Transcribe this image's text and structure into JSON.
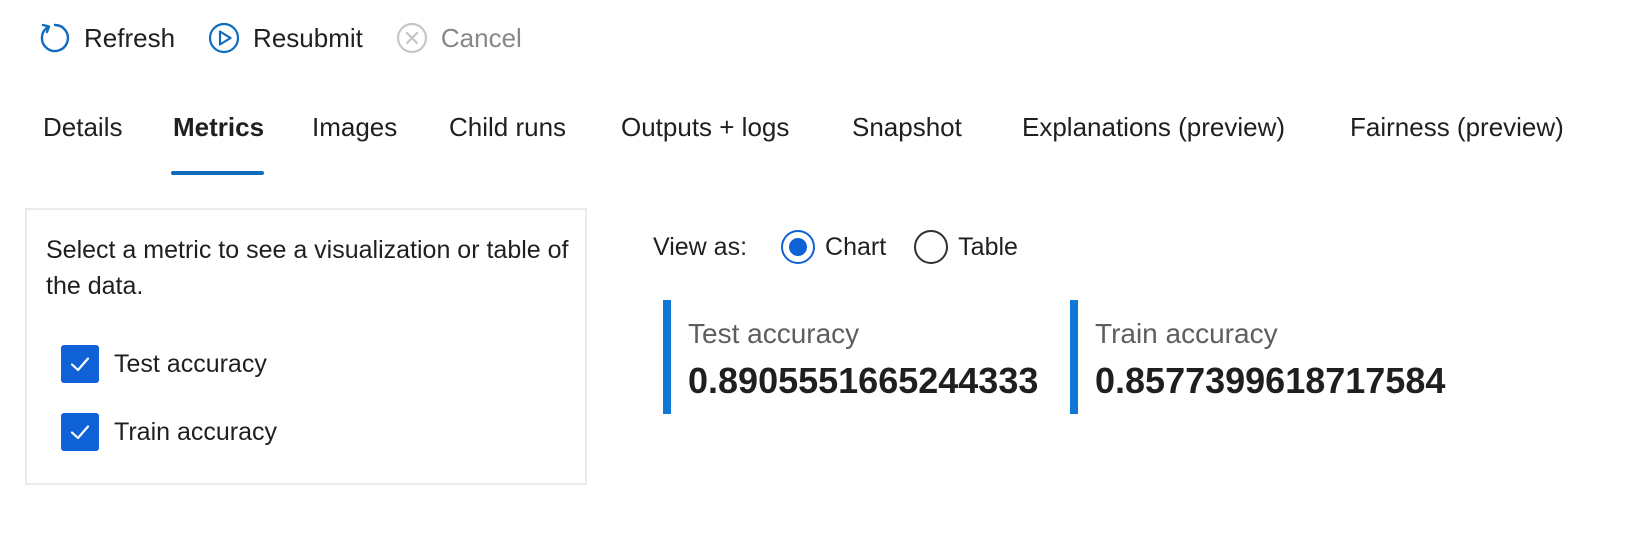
{
  "toolbar": {
    "refresh_label": "Refresh",
    "resubmit_label": "Resubmit",
    "cancel_label": "Cancel"
  },
  "tabs": [
    {
      "label": "Details",
      "active": false
    },
    {
      "label": "Metrics",
      "active": true
    },
    {
      "label": "Images",
      "active": false
    },
    {
      "label": "Child runs",
      "active": false
    },
    {
      "label": "Outputs + logs",
      "active": false
    },
    {
      "label": "Snapshot",
      "active": false
    },
    {
      "label": "Explanations (preview)",
      "active": false
    },
    {
      "label": "Fairness (preview)",
      "active": false
    }
  ],
  "metric_panel": {
    "hint": "Select a metric to see a visualization or table of the data.",
    "metrics": [
      {
        "label": "Test accuracy",
        "checked": true
      },
      {
        "label": "Train accuracy",
        "checked": true
      }
    ]
  },
  "view_as": {
    "label": "View as:",
    "options": [
      {
        "label": "Chart",
        "selected": true
      },
      {
        "label": "Table",
        "selected": false
      }
    ]
  },
  "cards": [
    {
      "name": "Test accuracy",
      "value": "0.8905551665244333"
    },
    {
      "name": "Train accuracy",
      "value": "0.8577399618717584"
    }
  ],
  "colors": {
    "accent": "#0f62d6",
    "card_bar": "#0f78d4",
    "tab_underline": "#0f6cbd",
    "disabled_text": "#8a8886"
  }
}
